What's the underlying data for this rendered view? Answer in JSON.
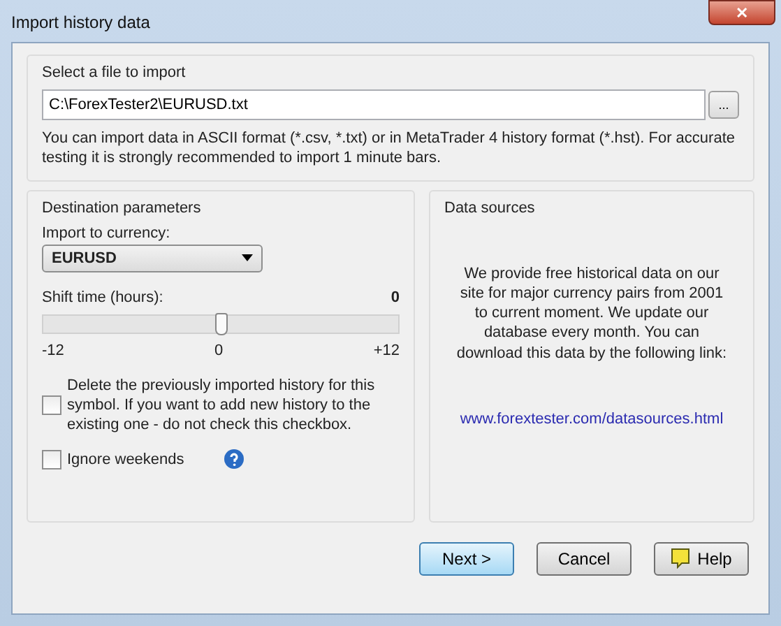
{
  "window": {
    "title": "Import history data",
    "close": "✕"
  },
  "file_group": {
    "title": "Select a file to import",
    "path": "C:\\ForexTester2\\EURUSD.txt",
    "browse": "...",
    "note": "You can import data in ASCII format (*.csv, *.txt) or in MetaTrader 4 history format (*.hst). For accurate testing it is strongly recommended to import 1 minute bars."
  },
  "destination": {
    "title": "Destination parameters",
    "currency_label": "Import to currency:",
    "currency": "EURUSD",
    "shift_label": "Shift time (hours):",
    "shift_value": "0",
    "shift": {
      "level": 0.5
    },
    "scale": [
      "-12",
      "0",
      "+12"
    ],
    "options": [
      {
        "label": "Delete the previously imported history for this symbol. If you want to add new history to the existing one - do not check this  checkbox.",
        "checked": false
      },
      {
        "label": "Ignore weekends",
        "checked": false,
        "help": true
      }
    ]
  },
  "sources": {
    "title": "Data sources",
    "text": "We provide free historical data on our site for major currency pairs from 2001 to current moment. We update our database every month. You can download this data by the following link:",
    "link": "www.forextester.com/datasources.html"
  },
  "buttons": [
    {
      "label": "Next >",
      "kind": "default"
    },
    {
      "label": "Cancel",
      "kind": "plain"
    },
    {
      "label": "Help",
      "kind": "help"
    }
  ]
}
